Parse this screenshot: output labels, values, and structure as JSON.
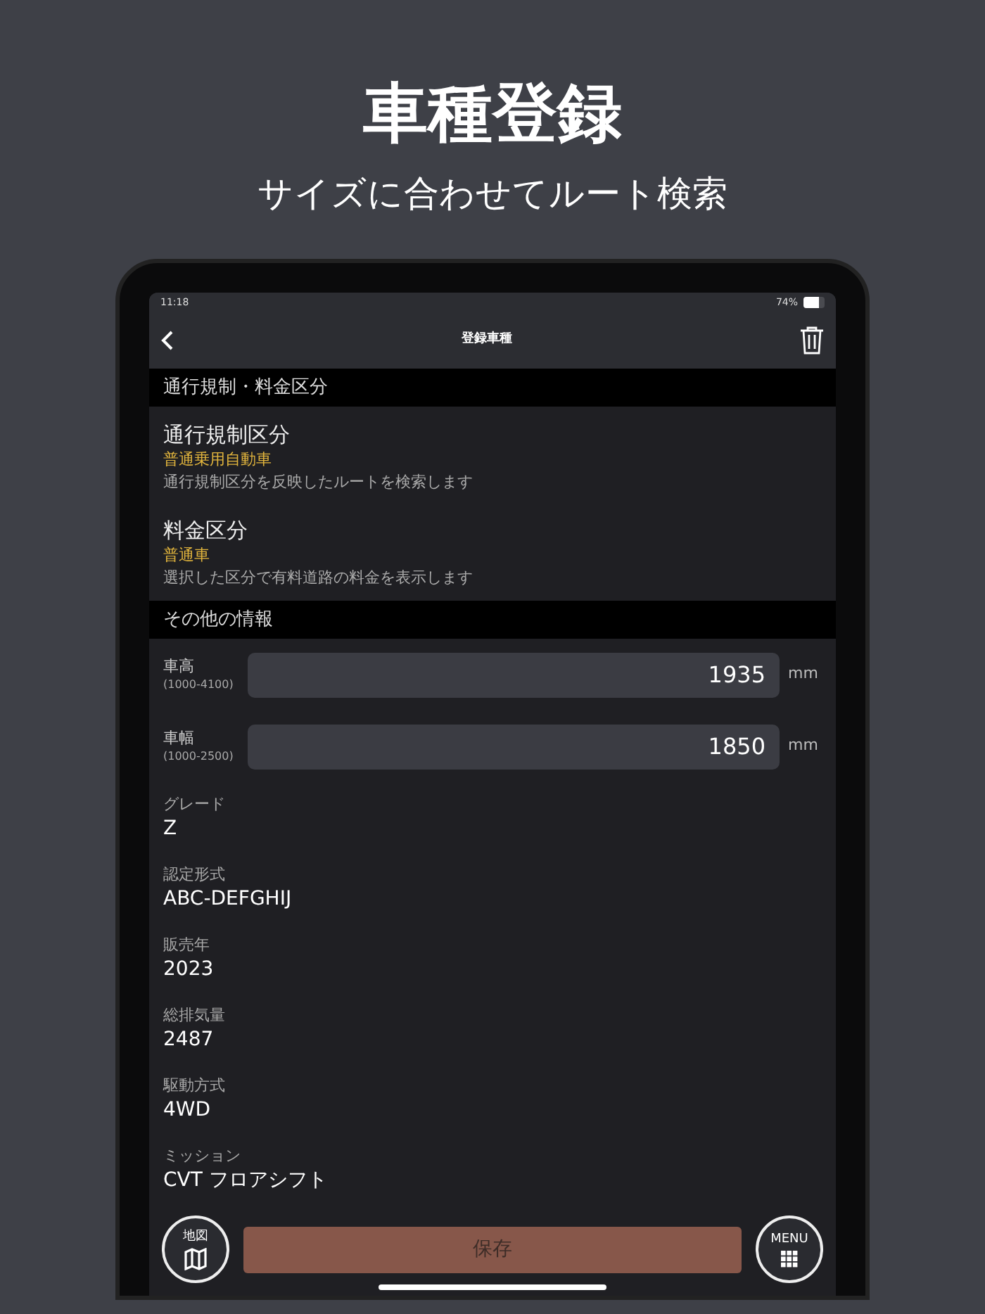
{
  "headline": {
    "title": "車種登録",
    "subtitle": "サイズに合わせてルート検索"
  },
  "status_bar": {
    "time": "11:18",
    "battery": {
      "label": "74%",
      "level": 0.74
    }
  },
  "nav": {
    "title": "登録車種"
  },
  "sections": [
    {
      "header": "通行規制・料金区分",
      "items": [
        {
          "kind": "choice",
          "label": "通行規制区分",
          "value": "普通乗用自動車",
          "description": "通行規制区分を反映したルートを検索します"
        },
        {
          "kind": "choice",
          "label": "料金区分",
          "value": "普通車",
          "description": "選択した区分で有料道路の料金を表示します"
        }
      ]
    },
    {
      "header": "その他の情報",
      "items": [
        {
          "kind": "input",
          "label": "車高",
          "range": "(1000-4100)",
          "value": "1935",
          "unit": "mm"
        },
        {
          "kind": "input",
          "label": "車幅",
          "range": "(1000-2500)",
          "value": "1850",
          "unit": "mm"
        },
        {
          "kind": "info",
          "label": "グレード",
          "value": "Z"
        },
        {
          "kind": "info",
          "label": "認定形式",
          "value": "ABC-DEFGHIJ"
        },
        {
          "kind": "info",
          "label": "販売年",
          "value": "2023"
        },
        {
          "kind": "info",
          "label": "総排気量",
          "value": "2487"
        },
        {
          "kind": "info",
          "label": "駆動方式",
          "value": "4WD"
        },
        {
          "kind": "info",
          "label": "ミッション",
          "value": "CVT フロアシフト"
        }
      ]
    }
  ],
  "bottom_bar": {
    "map_button": "地図",
    "save_button": {
      "label": "保存",
      "disabled": true
    },
    "menu_button": "MENU"
  }
}
